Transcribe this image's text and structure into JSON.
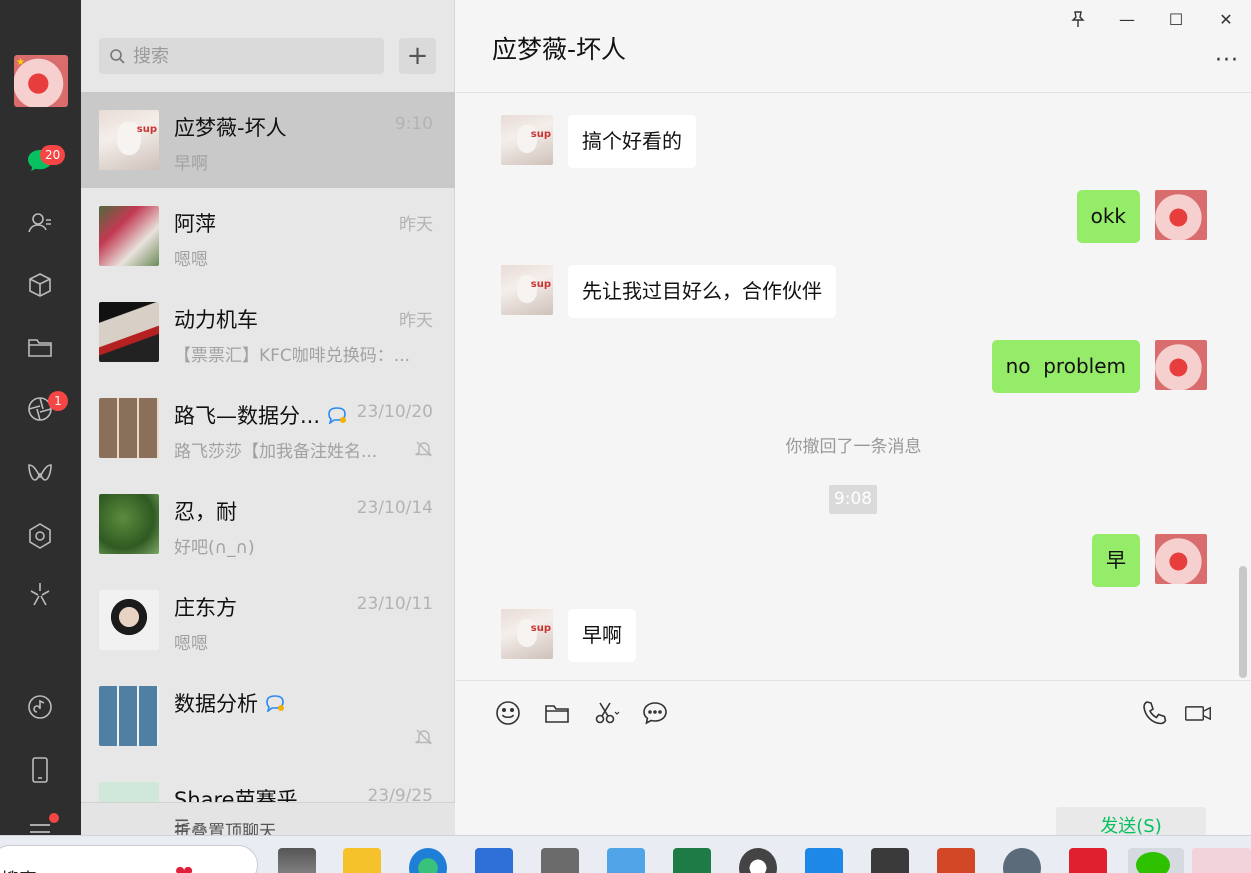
{
  "rail": {
    "chat_badge": "20",
    "moments_badge": "1"
  },
  "search": {
    "placeholder": "搜索",
    "add_label": "+"
  },
  "chats": [
    {
      "name": "应梦薇-坏人",
      "time": "9:10",
      "preview": "早啊",
      "active": true
    },
    {
      "name": "阿萍",
      "time": "昨天",
      "preview": "嗯嗯"
    },
    {
      "name": "动力机车",
      "time": "昨天",
      "preview": "【票票汇】KFC咖啡兑换码：..."
    },
    {
      "name": "路飞—数据分...",
      "time": "23/10/20",
      "preview": "路飞莎莎【加我备注姓名...",
      "muted": true
    },
    {
      "name": "忍，耐",
      "time": "23/10/14",
      "preview": "好吧(∩_∩)"
    },
    {
      "name": "庄东方",
      "time": "23/10/11",
      "preview": "嗯嗯"
    },
    {
      "name": "数据分析",
      "time": "",
      "preview": "",
      "muted": true
    },
    {
      "name": "Share芭赛乎",
      "time": "23/9/25",
      "preview": ""
    }
  ],
  "folded": {
    "label": "折叠置顶聊天"
  },
  "window": {
    "pin": "⊥",
    "minimize": "—",
    "maximize": "☐",
    "close": "✕"
  },
  "conversation": {
    "title": "应梦薇-坏人",
    "more": "···",
    "messages": [
      {
        "dir": "in",
        "text": "搞个好看的"
      },
      {
        "dir": "out",
        "text": "okk"
      },
      {
        "dir": "in",
        "text": "先让我过目好么，合作伙伴"
      },
      {
        "dir": "out",
        "text": "no  problem"
      },
      {
        "dir": "system",
        "text": "你撤回了一条消息"
      },
      {
        "dir": "time",
        "text": "9:08"
      },
      {
        "dir": "out",
        "text": "早"
      },
      {
        "dir": "in",
        "text": "早啊"
      }
    ]
  },
  "composer": {
    "send_label": "发送(S)"
  },
  "taskbar": {
    "search_label": "搜索"
  },
  "colors": {
    "accent": "#95ec69",
    "send_text": "#07c160",
    "badge": "#f54545"
  }
}
